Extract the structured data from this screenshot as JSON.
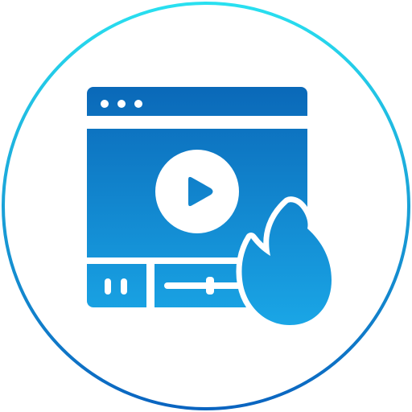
{
  "icon": {
    "name": "trending-video-icon",
    "description_components": [
      "browser-window",
      "play-button",
      "pause-button",
      "progress-slider",
      "flame"
    ],
    "colors": {
      "ring_top": "#29e0f0",
      "ring_bottom": "#0a64c0",
      "fill_top": "#0a68b8",
      "fill_bottom": "#1aa6e6",
      "background": "#ffffff",
      "cutout": "#ffffff"
    }
  }
}
